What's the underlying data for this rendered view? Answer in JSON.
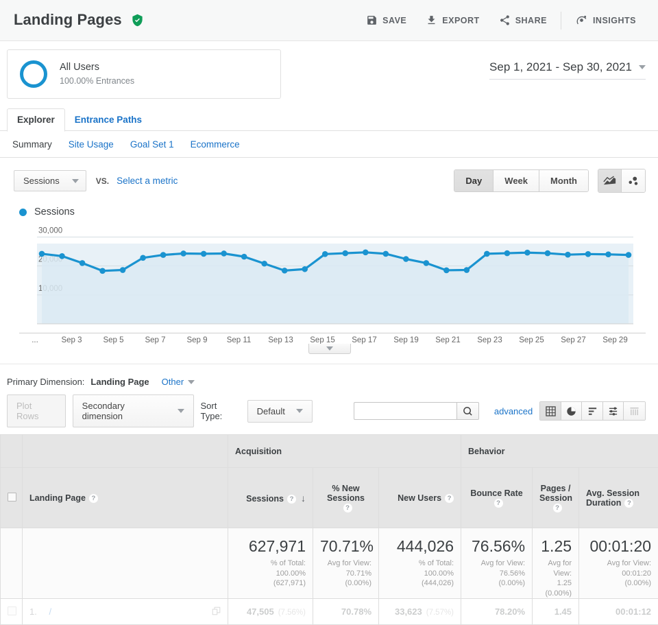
{
  "header": {
    "title": "Landing Pages",
    "verified_icon": "shield-check-icon",
    "actions": [
      {
        "label": "SAVE",
        "icon": "save-icon"
      },
      {
        "label": "EXPORT",
        "icon": "export-icon"
      },
      {
        "label": "SHARE",
        "icon": "share-icon"
      },
      {
        "label": "INSIGHTS",
        "icon": "insights-icon"
      }
    ]
  },
  "segment": {
    "name": "All Users",
    "subtitle": "100.00% Entrances"
  },
  "date_range": {
    "label": "Sep 1, 2021 - Sep 30, 2021",
    "caret_icon": "chevron-down-icon"
  },
  "tabs": [
    {
      "label": "Explorer",
      "active": true
    },
    {
      "label": "Entrance Paths",
      "active": false
    }
  ],
  "subnav": [
    {
      "label": "Summary",
      "active": true
    },
    {
      "label": "Site Usage",
      "active": false
    },
    {
      "label": "Goal Set 1",
      "active": false
    },
    {
      "label": "Ecommerce",
      "active": false
    }
  ],
  "chart_controls": {
    "metric_select": "Sessions",
    "vs_label": "VS.",
    "select_metric_link": "Select a metric",
    "granularity": [
      {
        "label": "Day",
        "active": true
      },
      {
        "label": "Week",
        "active": false
      },
      {
        "label": "Month",
        "active": false
      }
    ],
    "chart_types": [
      {
        "icon": "line-chart-icon",
        "active": true
      },
      {
        "icon": "motion-chart-icon",
        "active": false
      }
    ],
    "timeline_handle_icon": "chevron-down-icon"
  },
  "chart_data": {
    "type": "area",
    "title": "Sessions",
    "series_name": "Sessions",
    "series_color": "#1a93d0",
    "xlabel": "",
    "ylabel": "",
    "ylim": [
      0,
      32000
    ],
    "yticks": [
      "10,000",
      "20,000",
      "30,000"
    ],
    "ytick_values": [
      10000,
      20000,
      30000
    ],
    "grid": true,
    "legend_position": "top-left",
    "x_first_label": "...",
    "xtick_labels": [
      "Sep 3",
      "Sep 5",
      "Sep 7",
      "Sep 9",
      "Sep 11",
      "Sep 13",
      "Sep 15",
      "Sep 17",
      "Sep 19",
      "Sep 21",
      "Sep 23",
      "Sep 25",
      "Sep 27",
      "Sep 29"
    ],
    "x": [
      "Sep 1",
      "Sep 2",
      "Sep 3",
      "Sep 4",
      "Sep 5",
      "Sep 6",
      "Sep 7",
      "Sep 8",
      "Sep 9",
      "Sep 10",
      "Sep 11",
      "Sep 12",
      "Sep 13",
      "Sep 14",
      "Sep 15",
      "Sep 16",
      "Sep 17",
      "Sep 18",
      "Sep 19",
      "Sep 20",
      "Sep 21",
      "Sep 22",
      "Sep 23",
      "Sep 24",
      "Sep 25",
      "Sep 26",
      "Sep 27",
      "Sep 28",
      "Sep 29",
      "Sep 30"
    ],
    "values": [
      24200,
      23400,
      21000,
      18300,
      18600,
      22800,
      23800,
      24300,
      24200,
      24300,
      23200,
      20800,
      18400,
      18900,
      24100,
      24400,
      24700,
      24200,
      22400,
      21000,
      18500,
      18600,
      24200,
      24400,
      24600,
      24400,
      23900,
      24100,
      24000,
      23800
    ]
  },
  "primary_dimension": {
    "label": "Primary Dimension:",
    "value": "Landing Page",
    "other_label": "Other",
    "other_caret_icon": "chevron-down-icon"
  },
  "table_controls": {
    "plot_rows": "Plot Rows",
    "secondary_dimension": "Secondary dimension",
    "sort_type_label": "Sort Type:",
    "sort_type_value": "Default",
    "search_value": "",
    "search_placeholder": "",
    "search_icon": "search-icon",
    "advanced_link": "advanced",
    "view_icons": [
      {
        "icon": "table-view-icon",
        "active": true
      },
      {
        "icon": "pie-chart-view-icon",
        "active": false
      },
      {
        "icon": "bar-chart-view-icon",
        "active": false
      },
      {
        "icon": "comparison-view-icon",
        "active": false
      },
      {
        "icon": "pivot-view-icon",
        "active": false
      }
    ]
  },
  "table": {
    "group_headers": [
      {
        "label": "Acquisition"
      },
      {
        "label": "Behavior"
      }
    ],
    "dimension_header": "Landing Page",
    "columns": [
      {
        "label": "Sessions",
        "has_help": true,
        "sorted": true,
        "sort_icon": "arrow-down-icon"
      },
      {
        "label": "% New\nSessions",
        "has_help": true
      },
      {
        "label": "New Users",
        "has_help": true
      },
      {
        "label": "Bounce Rate",
        "has_help": true
      },
      {
        "label": "Pages /\nSession",
        "has_help": true
      },
      {
        "label": "Avg. Session\nDuration",
        "has_help": true
      }
    ],
    "summary": [
      {
        "big": "627,971",
        "lines": [
          "% of Total:",
          "100.00%",
          "(627,971)"
        ]
      },
      {
        "big": "70.71%",
        "lines": [
          "Avg for View:",
          "70.71%",
          "(0.00%)"
        ]
      },
      {
        "big": "444,026",
        "lines": [
          "% of Total:",
          "100.00%",
          "(444,026)"
        ]
      },
      {
        "big": "76.56%",
        "lines": [
          "Avg for View:",
          "76.56%",
          "(0.00%)"
        ]
      },
      {
        "big": "1.25",
        "lines": [
          "Avg for",
          "View:",
          "1.25",
          "(0.00%)"
        ]
      },
      {
        "big": "00:01:20",
        "lines": [
          "Avg for View:",
          "00:01:20",
          "(0.00%)"
        ]
      }
    ],
    "rows": [
      {
        "index": "1.",
        "page": "/",
        "external_icon": "open-in-new-icon",
        "sessions": "47,505",
        "sessions_pct": "(7.56%)",
        "new_sessions_pct": "70.78%",
        "new_users": "33,623",
        "new_users_pct": "(7.57%)",
        "bounce_rate": "78.20%",
        "pages_per_session": "1.45",
        "avg_duration": "00:01:12"
      }
    ]
  }
}
